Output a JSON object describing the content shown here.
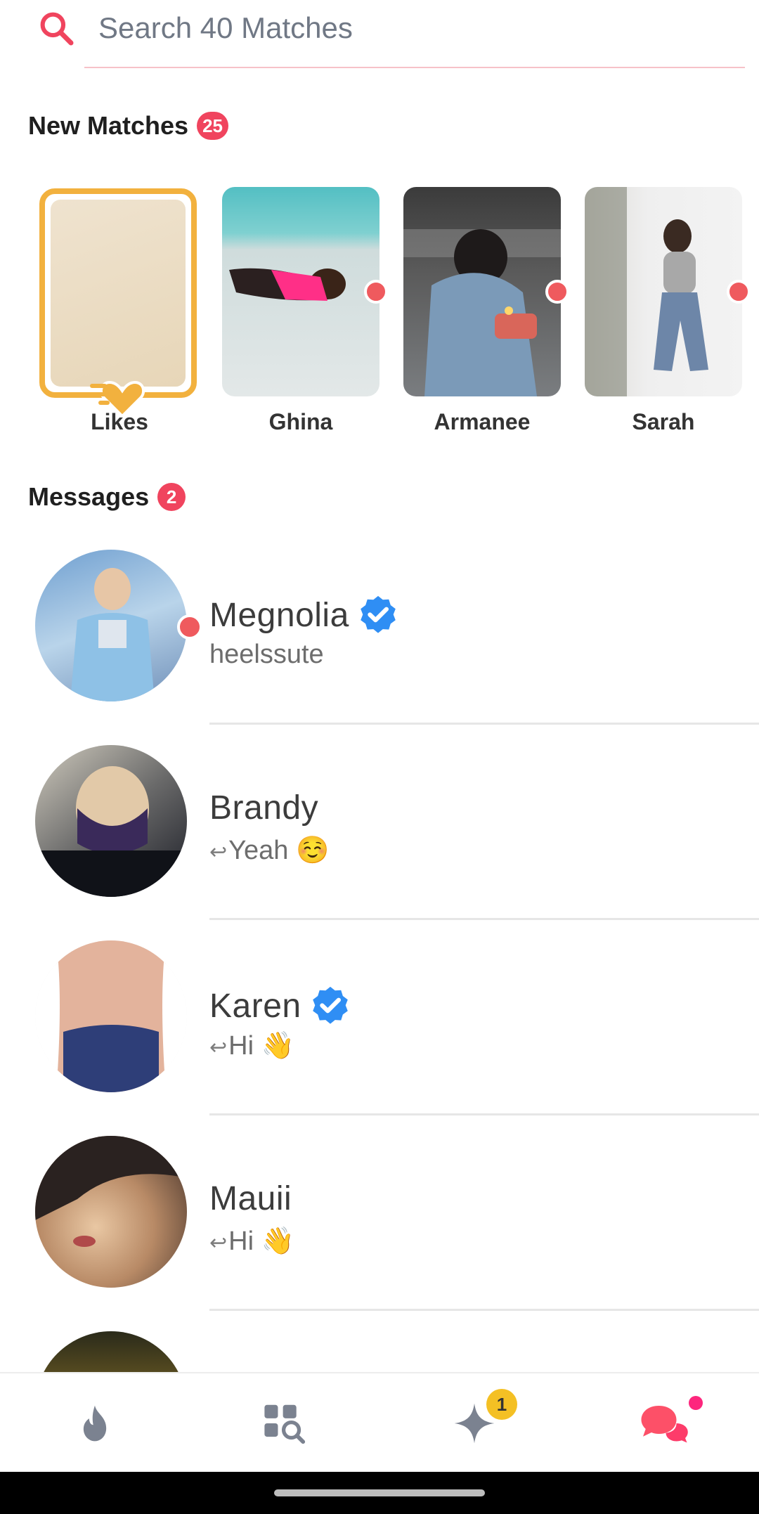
{
  "search": {
    "placeholder": "Search 40 Matches"
  },
  "new_matches": {
    "title": "New Matches",
    "count": "25",
    "likes_label": "Likes",
    "items": [
      {
        "name": "Ghina"
      },
      {
        "name": "Armanee"
      },
      {
        "name": "Sarah"
      }
    ]
  },
  "messages": {
    "title": "Messages",
    "count": "2",
    "items": [
      {
        "name": "Megnolia",
        "preview": "heelssute",
        "verified": true,
        "online": true
      },
      {
        "name": "Brandy",
        "preview": "Yeah ☺️",
        "verified": false,
        "replied": true
      },
      {
        "name": "Karen",
        "preview": "Hi 👋",
        "verified": true,
        "replied": true
      },
      {
        "name": "Mauii",
        "preview": "Hi 👋",
        "verified": false,
        "replied": true
      }
    ]
  },
  "tabbar": {
    "icons": [
      "flame-icon",
      "explore-icon",
      "gold-spark-icon",
      "chat-icon"
    ],
    "spark_badge": "1"
  },
  "colors": {
    "accent": "#f0445e",
    "likes_gold": "#f2b13e",
    "verified_blue": "#2f8ef4",
    "chat_active": "#fd5068"
  }
}
